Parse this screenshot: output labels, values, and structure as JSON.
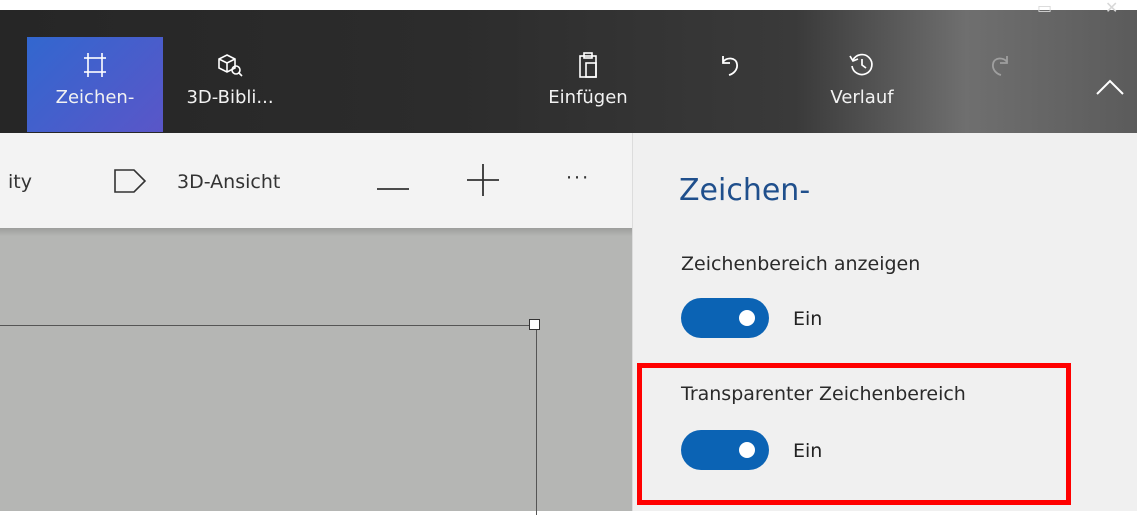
{
  "ribbon": {
    "buttons": [
      {
        "label": "Zeichen-",
        "icon": "canvas-crop-icon",
        "active": true
      },
      {
        "label": "3D-Bibli...",
        "icon": "3d-library-icon"
      },
      {
        "label": "Einfügen",
        "icon": "paste-icon"
      },
      {
        "label": "",
        "icon": "undo-icon"
      },
      {
        "label": "Verlauf",
        "icon": "history-icon"
      },
      {
        "label": "",
        "icon": "redo-icon",
        "disabled": true
      },
      {
        "label": "",
        "icon": "collapse-chevron-icon"
      }
    ]
  },
  "toolbar": {
    "truncated_text": "ity",
    "view3d_label": "3D-Ansicht",
    "zoom_out": "—",
    "zoom_in": "+",
    "more": "···"
  },
  "panel": {
    "title": "Zeichen-",
    "options": [
      {
        "label": "Zeichenbereich anzeigen",
        "state": "Ein",
        "on": true
      },
      {
        "label": "Transparenter Zeichenbereich",
        "state": "Ein",
        "on": true
      }
    ]
  },
  "colors": {
    "accent": "#0b63b4",
    "ribbon_active": "#3b62d0",
    "panel_title": "#1f4f8c",
    "highlight": "#ff0000",
    "canvas": "#b5b6b4"
  }
}
